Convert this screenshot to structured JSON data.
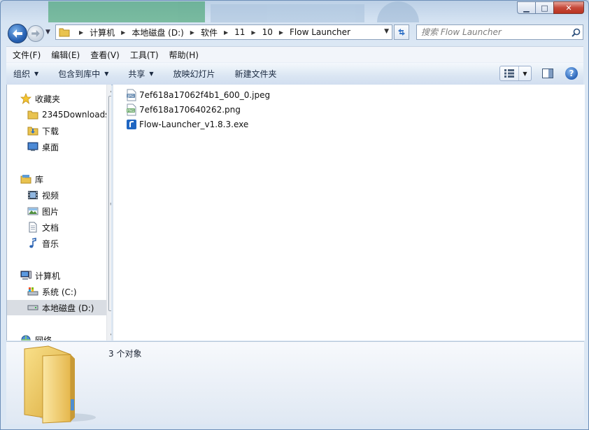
{
  "window": {
    "caption": {
      "minimize": "▁",
      "maximize": "□",
      "close": "✕"
    }
  },
  "nav": {
    "breadcrumb": [
      "计算机",
      "本地磁盘 (D:)",
      "软件",
      "11",
      "10",
      "Flow Launcher"
    ],
    "search_placeholder": "搜索 Flow Launcher"
  },
  "menu": [
    "文件(F)",
    "编辑(E)",
    "查看(V)",
    "工具(T)",
    "帮助(H)"
  ],
  "commands": [
    {
      "label": "组织",
      "dropdown": true
    },
    {
      "label": "包含到库中",
      "dropdown": true
    },
    {
      "label": "共享",
      "dropdown": true
    },
    {
      "label": "放映幻灯片",
      "dropdown": false
    },
    {
      "label": "新建文件夹",
      "dropdown": false
    }
  ],
  "sidebar": {
    "favorites": {
      "label": "收藏夹",
      "icon": "star-icon"
    },
    "favorite_items": [
      {
        "label": "2345Downloads",
        "icon": "folder-icon"
      },
      {
        "label": "下载",
        "icon": "download-folder-icon"
      },
      {
        "label": "桌面",
        "icon": "desktop-icon"
      }
    ],
    "libraries": {
      "label": "库",
      "icon": "library-icon"
    },
    "library_items": [
      {
        "label": "视频",
        "icon": "video-icon"
      },
      {
        "label": "图片",
        "icon": "picture-icon"
      },
      {
        "label": "文档",
        "icon": "document-icon"
      },
      {
        "label": "音乐",
        "icon": "music-icon"
      }
    ],
    "computer": {
      "label": "计算机",
      "icon": "computer-icon"
    },
    "drives": [
      {
        "label": "系统 (C:)",
        "icon": "system-drive-icon",
        "selected": false
      },
      {
        "label": "本地磁盘 (D:)",
        "icon": "drive-icon",
        "selected": true
      }
    ],
    "network": {
      "label": "网络",
      "icon": "network-icon"
    }
  },
  "files": [
    {
      "name": "7ef618a17062f4b1_600_0.jpeg",
      "icon": "jpeg-file-icon",
      "badge": "JPG",
      "badge_color": "#6d8fb3"
    },
    {
      "name": "7ef618a170640262.png",
      "icon": "png-file-icon",
      "badge": "PNG",
      "badge_color": "#6aa86a"
    },
    {
      "name": "Flow-Launcher_v1.8.3.exe",
      "icon": "flow-launcher-exe-icon",
      "badge": "",
      "badge_color": "#1f66c2"
    }
  ],
  "details": {
    "count_text": "3 个对象"
  }
}
